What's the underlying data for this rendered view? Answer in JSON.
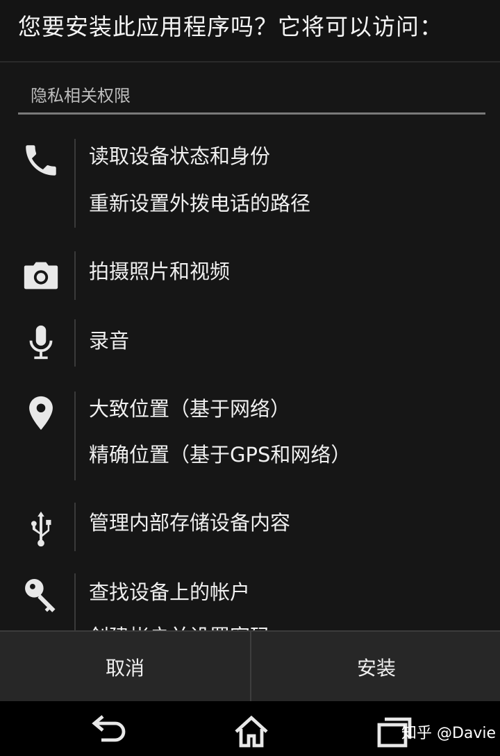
{
  "header": {
    "title": "您要安装此应用程序吗？它将可以访问："
  },
  "section": {
    "label": "隐私相关权限"
  },
  "permissions": [
    {
      "icon": "phone-icon",
      "lines": [
        "读取设备状态和身份",
        "重新设置外拨电话的路径"
      ]
    },
    {
      "icon": "camera-icon",
      "lines": [
        "拍摄照片和视频"
      ]
    },
    {
      "icon": "microphone-icon",
      "lines": [
        "录音"
      ]
    },
    {
      "icon": "location-pin-icon",
      "lines": [
        "大致位置（基于网络）",
        "精确位置（基于GPS和网络）"
      ]
    },
    {
      "icon": "usb-icon",
      "lines": [
        "管理内部存储设备内容"
      ]
    },
    {
      "icon": "key-icon",
      "lines": [
        "查找设备上的帐户",
        "创建帐户并设置密码"
      ]
    }
  ],
  "buttons": {
    "cancel_label": "取消",
    "install_label": "安装"
  },
  "nav": {
    "icons": [
      "back-icon",
      "home-icon",
      "recent-apps-icon"
    ]
  },
  "watermark": {
    "text": "知乎 @Davie"
  }
}
